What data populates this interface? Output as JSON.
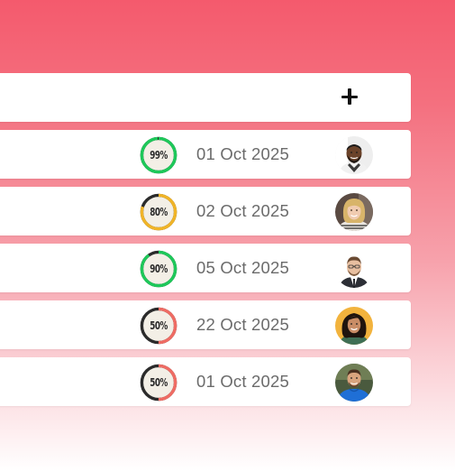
{
  "header": {
    "add_button_icon": "plus-icon"
  },
  "rows": [
    {
      "progress_label": "99%",
      "progress_value": 0.99,
      "status_color": "#1ec85a",
      "date": "01 Oct 2025",
      "avatar_icon": "user-avatar-man-beard"
    },
    {
      "progress_label": "80%",
      "progress_value": 0.8,
      "status_color": "#f0b428",
      "date": "02 Oct 2025",
      "avatar_icon": "user-avatar-woman-blonde"
    },
    {
      "progress_label": "90%",
      "progress_value": 0.9,
      "status_color": "#1ec85a",
      "date": "05 Oct 2025",
      "avatar_icon": "user-avatar-man-suit"
    },
    {
      "progress_label": "50%",
      "progress_value": 0.5,
      "status_color": "#ef6c64",
      "date": "22 Oct 2025",
      "avatar_icon": "user-avatar-woman-curly"
    },
    {
      "progress_label": "50%",
      "progress_value": 0.5,
      "status_color": "#ef6c64",
      "date": "01 Oct 2025",
      "avatar_icon": "user-avatar-man-blue-shirt"
    }
  ]
}
